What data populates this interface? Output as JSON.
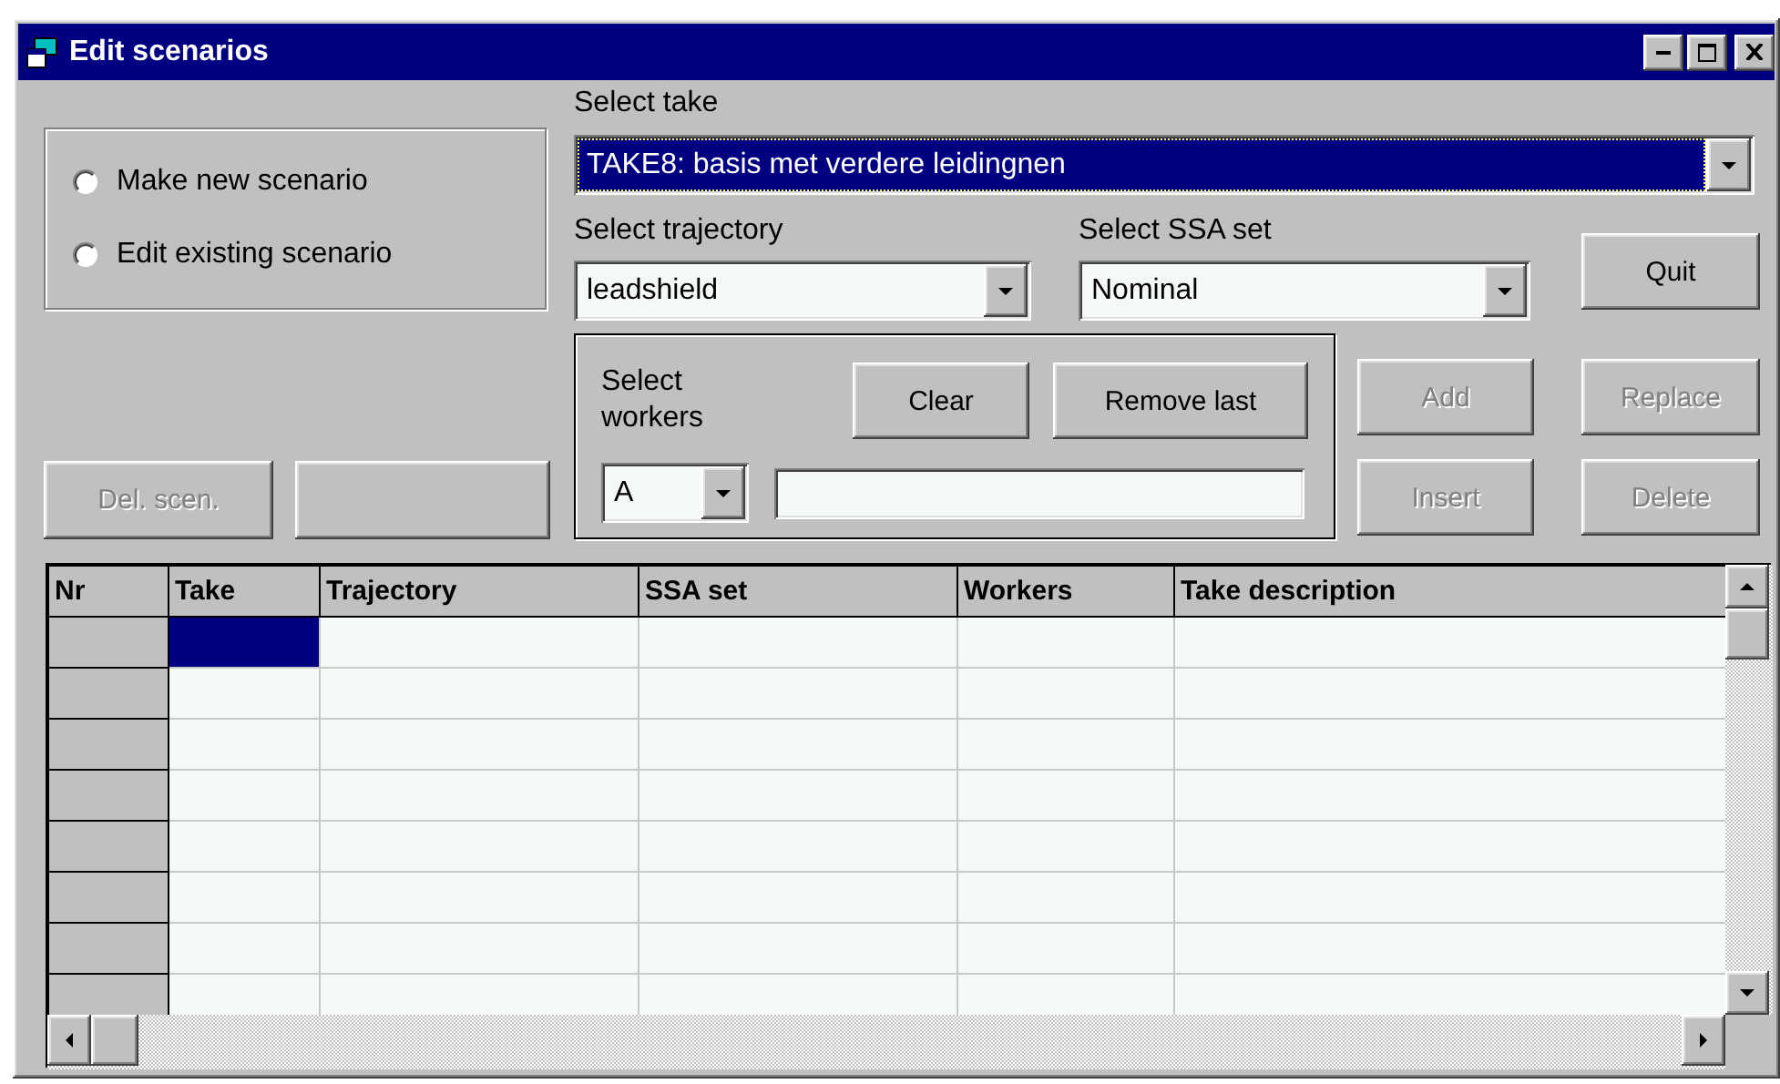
{
  "window": {
    "title": "Edit scenarios"
  },
  "scenario_mode": [
    {
      "label": "Make new scenario",
      "selected": false
    },
    {
      "label": "Edit existing scenario",
      "selected": false
    }
  ],
  "del_scen_button": {
    "label": "Del. scen.",
    "disabled": true
  },
  "take": {
    "label": "Select take",
    "value": "TAKE8: basis met verdere leidingnen",
    "highlighted": true
  },
  "trajectory": {
    "label": "Select trajectory",
    "value": "leadshield"
  },
  "ssa_set": {
    "label": "Select SSA set",
    "value": "Nominal"
  },
  "quit_button": {
    "label": "Quit",
    "disabled": false
  },
  "workers": {
    "label": "Select workers",
    "value": "A"
  },
  "clear_button": {
    "label": "Clear",
    "disabled": false
  },
  "remove_last_button": {
    "label": "Remove last",
    "disabled": false
  },
  "add_button": {
    "label": "Add",
    "disabled": true
  },
  "replace_button": {
    "label": "Replace",
    "disabled": true
  },
  "insert_button": {
    "label": "Insert",
    "disabled": true
  },
  "delete_button": {
    "label": "Delete",
    "disabled": true
  },
  "grid": {
    "columns": [
      "Nr",
      "Take",
      "Trajectory",
      "SSA set",
      "Workers",
      "Take description"
    ],
    "rows": [
      {
        "cells": [
          {
            "selected": true
          },
          {
            "selected": false
          },
          {
            "selected": false
          },
          {
            "selected": false
          },
          {
            "selected": false
          }
        ]
      },
      {
        "cells": [
          {
            "selected": false
          },
          {
            "selected": false
          },
          {
            "selected": false
          },
          {
            "selected": false
          },
          {
            "selected": false
          }
        ]
      },
      {
        "cells": [
          {
            "selected": false
          },
          {
            "selected": false
          },
          {
            "selected": false
          },
          {
            "selected": false
          },
          {
            "selected": false
          }
        ]
      },
      {
        "cells": [
          {
            "selected": false
          },
          {
            "selected": false
          },
          {
            "selected": false
          },
          {
            "selected": false
          },
          {
            "selected": false
          }
        ]
      },
      {
        "cells": [
          {
            "selected": false
          },
          {
            "selected": false
          },
          {
            "selected": false
          },
          {
            "selected": false
          },
          {
            "selected": false
          }
        ]
      },
      {
        "cells": [
          {
            "selected": false
          },
          {
            "selected": false
          },
          {
            "selected": false
          },
          {
            "selected": false
          },
          {
            "selected": false
          }
        ]
      },
      {
        "cells": [
          {
            "selected": false
          },
          {
            "selected": false
          },
          {
            "selected": false
          },
          {
            "selected": false
          },
          {
            "selected": false
          }
        ]
      },
      {
        "cells": [
          {
            "selected": false
          },
          {
            "selected": false
          },
          {
            "selected": false
          },
          {
            "selected": false
          },
          {
            "selected": false
          }
        ]
      }
    ]
  }
}
